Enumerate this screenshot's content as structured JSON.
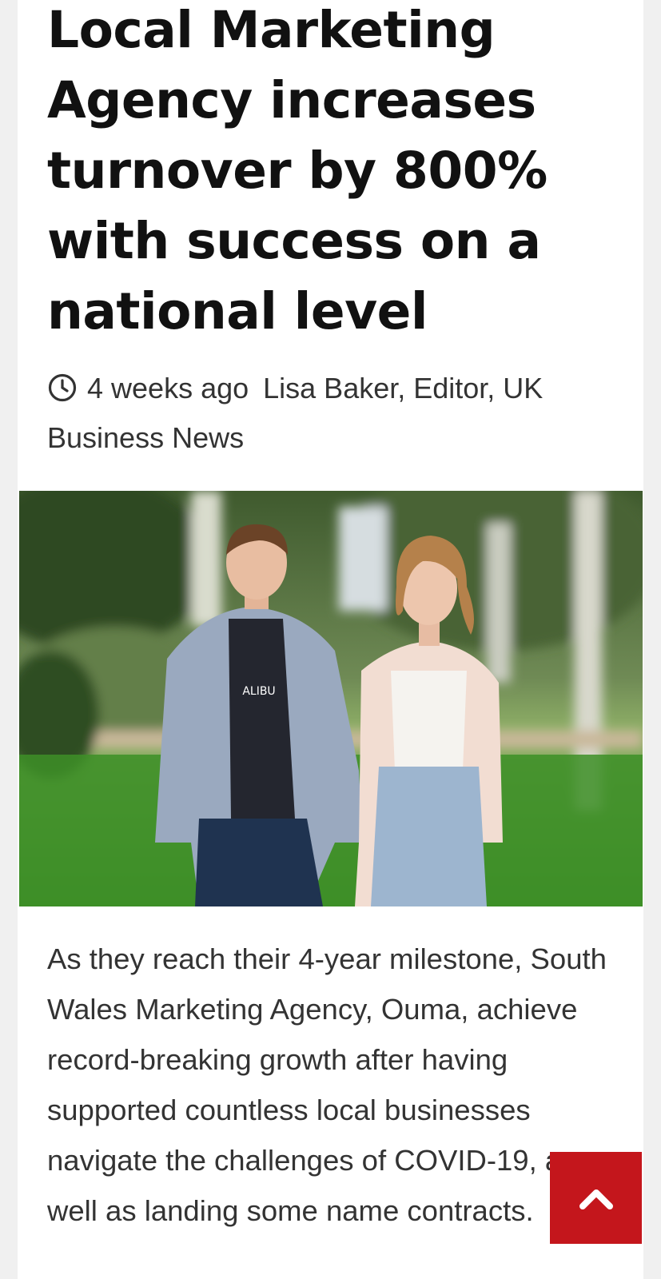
{
  "article": {
    "headline": "Local Marketing Agency increases turnover by 800% with success on a national level",
    "posted": "4 weeks ago",
    "author": "Lisa Baker, Editor, UK Business News",
    "image_shirt_text": "ALIBU",
    "body": "As they reach their 4-year milestone, South Wales Marketing Agency, Ouma, achieve record-breaking growth after having supported countless local businesses navigate the challenges of COVID-19, as well as landing some name contracts."
  },
  "icons": {
    "clock": "clock-icon",
    "back_to_top": "chevron-up-icon"
  },
  "colors": {
    "accent": "#c4161c",
    "headline": "#111111",
    "text": "#333333"
  }
}
